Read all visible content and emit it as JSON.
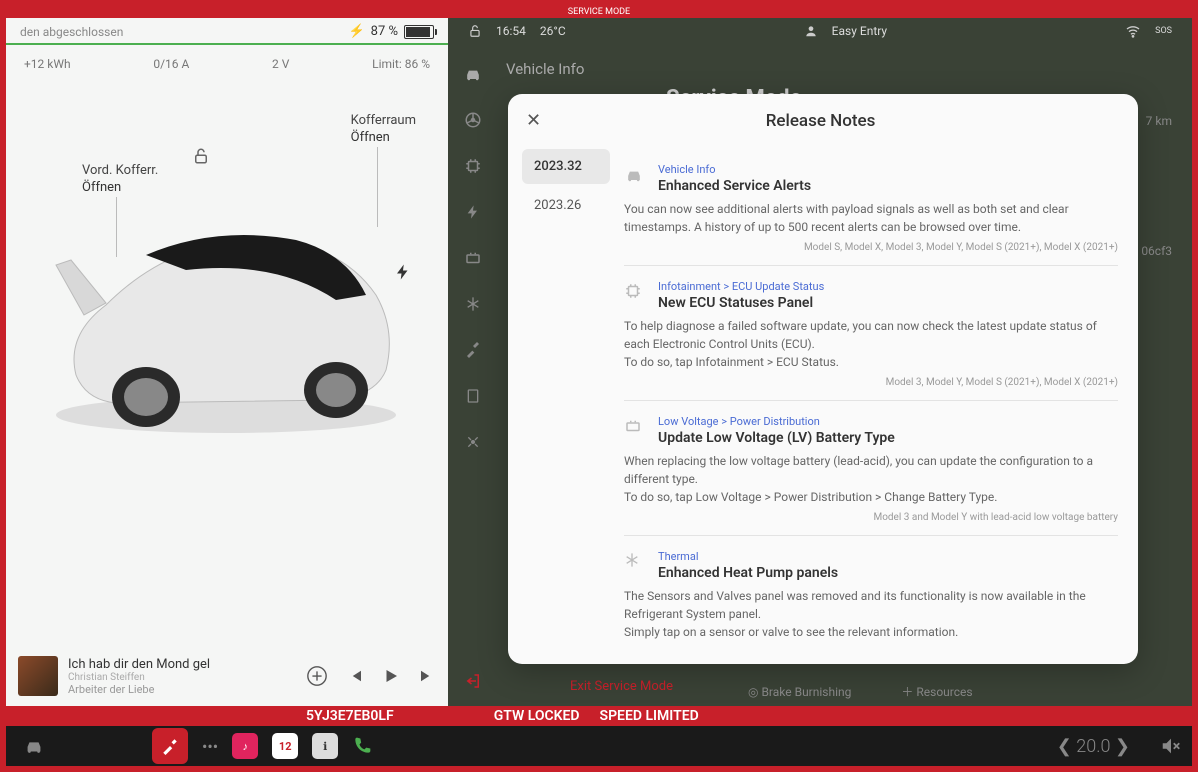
{
  "top_banner": "SERVICE MODE",
  "left": {
    "status_text": "den abgeschlossen",
    "battery_pct": "87 %",
    "stats": {
      "kwh": "+12 kWh",
      "amps": "0/16 A",
      "volts": "2 V",
      "limit": "Limit: 86 %"
    },
    "frunk_label": "Vord. Kofferr.",
    "frunk_action": "Öffnen",
    "trunk_label": "Kofferraum",
    "trunk_action": "Öffnen",
    "media": {
      "title": "Ich hab dir den Mond gel",
      "artist": "Arbeiter der Liebe",
      "author": "Christian Steiffen"
    }
  },
  "right": {
    "time": "16:54",
    "temp": "26°C",
    "profile": "Easy Entry",
    "crumb": "Vehicle Info",
    "header": "Service Mode",
    "km_suffix": "7 km",
    "hash_suffix": "06cf3",
    "exit_label": "Exit Service Mode",
    "bottom_btn1": "Brake Burnishing",
    "bottom_btn2": "Resources"
  },
  "red_bar": {
    "vin": "5YJ3E7EB0LF",
    "lock": "GTW LOCKED",
    "speed": "SPEED LIMITED"
  },
  "dock": {
    "temp_display": "20.0",
    "cal_day": "12"
  },
  "modal": {
    "title": "Release Notes",
    "versions": [
      "2023.32",
      "2023.26"
    ],
    "notes": [
      {
        "category": "Vehicle Info",
        "title": "Enhanced Service Alerts",
        "body": "You can now see additional alerts with payload signals as well as both set and clear timestamps. A history of up to 500 recent alerts can be browsed over time.",
        "models": "Model S, Model X, Model 3, Model Y, Model S (2021+), Model X (2021+)"
      },
      {
        "category": "Infotainment > ECU Update Status",
        "title": "New ECU Statuses Panel",
        "body": "To help diagnose a failed software update, you can now check the latest update status of each Electronic Control Units (ECU).\nTo do so, tap Infotainment > ECU Status.",
        "models": "Model 3, Model Y, Model S (2021+), Model X (2021+)"
      },
      {
        "category": "Low Voltage > Power Distribution",
        "title": "Update Low Voltage (LV) Battery Type",
        "body": "When replacing the low voltage battery (lead-acid), you can update the configuration to a different type.\nTo do so, tap Low Voltage > Power Distribution > Change Battery Type.",
        "models": "Model 3 and Model Y with lead-acid low voltage battery"
      },
      {
        "category": "Thermal",
        "title": "Enhanced Heat Pump panels",
        "body": "The Sensors and Valves panel was removed and its functionality is now available in the Refrigerant System panel.\nSimply tap on a sensor or valve to see the relevant information.",
        "models": ""
      }
    ]
  }
}
